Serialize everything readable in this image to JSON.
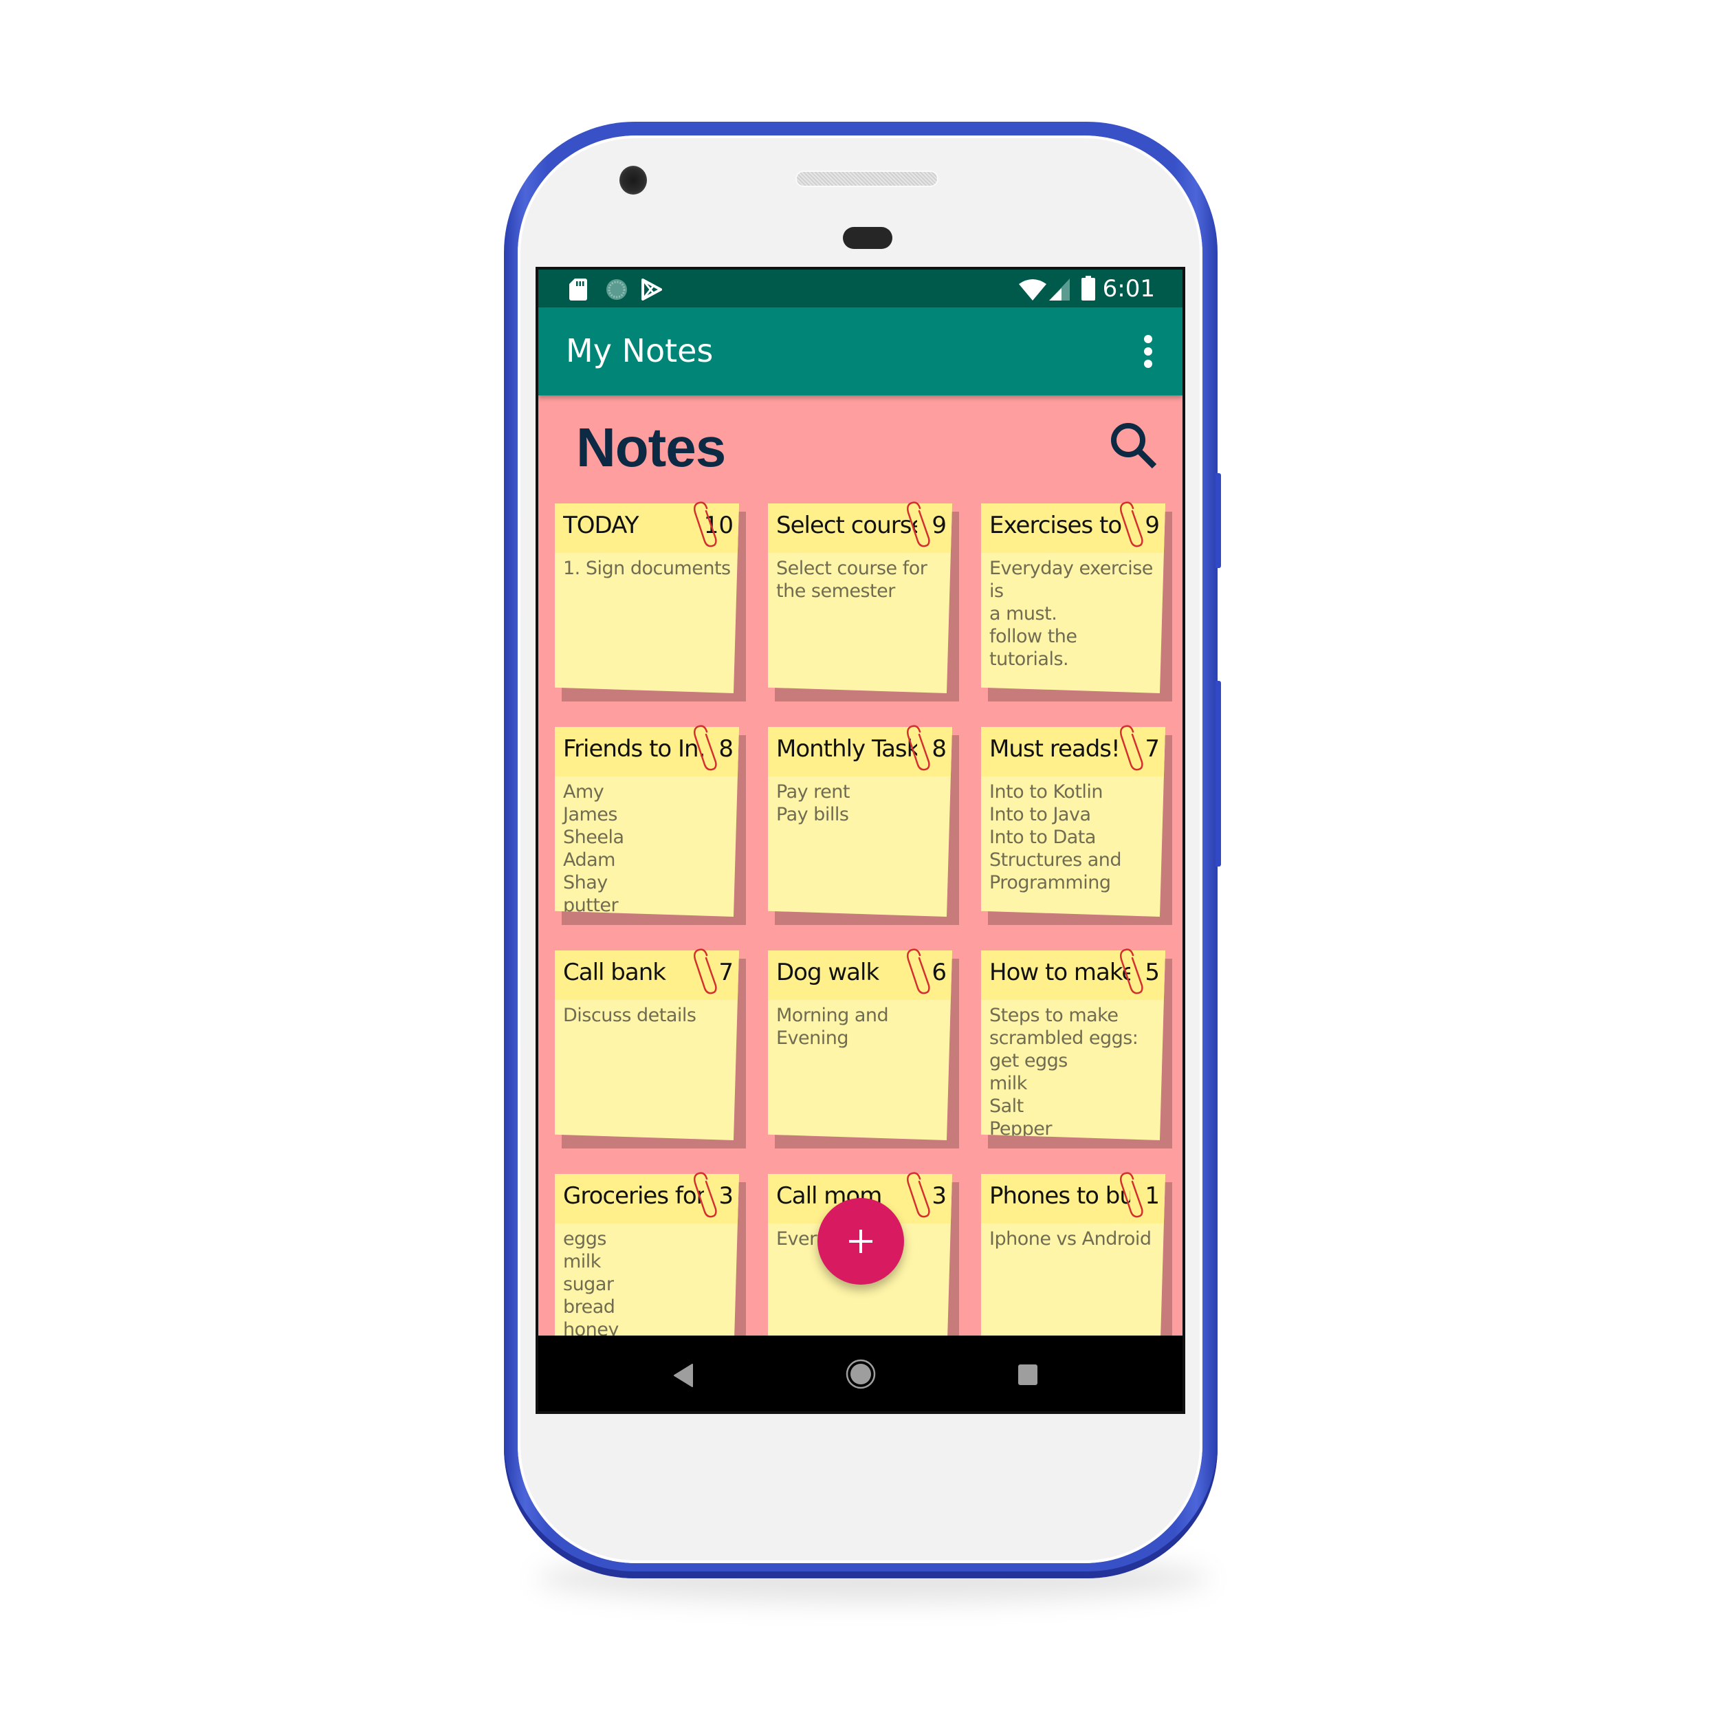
{
  "status_bar": {
    "left_icons": [
      "sd-card-icon",
      "loading-circle-icon",
      "play-store-icon"
    ],
    "right_icons": [
      "wifi-icon",
      "cell-signal-icon",
      "battery-icon"
    ],
    "time": "6:01"
  },
  "toolbar": {
    "title": "My Notes",
    "overflow_icon": "more-vert-icon"
  },
  "page": {
    "title": "Notes",
    "search_icon": "search-icon"
  },
  "notes": [
    {
      "title": "TODAY",
      "count": "10",
      "body": "1. Sign documents"
    },
    {
      "title": "Select course",
      "count": "9",
      "body": "Select course for\nthe semester"
    },
    {
      "title": "Exercises to ...",
      "count": "9",
      "body": "Everyday exercise is\na must.\nfollow the tutorials."
    },
    {
      "title": "Friends to In...",
      "count": "8",
      "body": "Amy\nJames\nSheela\nAdam\nShay\nputter"
    },
    {
      "title": "Monthly Tasks",
      "count": "8",
      "body": "Pay rent\nPay bills"
    },
    {
      "title": "Must reads!",
      "count": "7",
      "body": "Into to Kotlin\nInto to Java\nInto to Data\nStructures and\nProgramming"
    },
    {
      "title": "Call bank",
      "count": "7",
      "body": "Discuss details"
    },
    {
      "title": "Dog walk",
      "count": "6",
      "body": "Morning and\nEvening"
    },
    {
      "title": "How to make...",
      "count": "5",
      "body": "Steps to make\nscrambled eggs:\nget eggs\nmilk\nSalt\nPepper"
    },
    {
      "title": "Groceries for...",
      "count": "3",
      "body": "eggs\nmilk\nsugar\nbread\nhoney"
    },
    {
      "title": "Call mom",
      "count": "3",
      "body": "Every"
    },
    {
      "title": "Phones to buy",
      "count": "1",
      "body": "Iphone vs Android"
    }
  ],
  "fab": {
    "icon": "plus-icon",
    "label": "+"
  },
  "nav_bar": {
    "back": "back-icon",
    "home": "home-icon",
    "recents": "recents-icon"
  },
  "colors": {
    "status_bar": "#005a4c",
    "toolbar": "#008577",
    "background": "#ff9e9e",
    "note_header": "#fff08c",
    "note_body": "#fff5a8",
    "fab": "#d81b60",
    "title_text": "#0d2a45",
    "phone_frame": "#3851c7"
  }
}
